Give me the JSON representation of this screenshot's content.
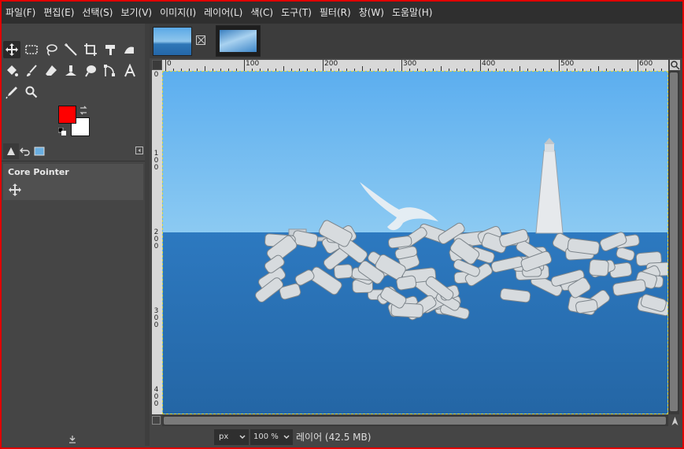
{
  "menu": [
    "파일(F)",
    "편집(E)",
    "선택(S)",
    "보기(V)",
    "이미지(I)",
    "레이어(L)",
    "색(C)",
    "도구(T)",
    "필터(R)",
    "창(W)",
    "도움말(H)"
  ],
  "tool_options": {
    "title": "Core Pointer"
  },
  "colors": {
    "foreground": "#ff0000",
    "background": "#ffffff",
    "accent": "#e00000"
  },
  "ruler": {
    "h_labels": [
      "0",
      "100",
      "200",
      "300",
      "400",
      "500",
      "600"
    ],
    "v_labels": [
      "0",
      "1 0 0",
      "2 0 0",
      "3 0 0",
      "4 0 0"
    ]
  },
  "status": {
    "unit": "px",
    "zoom": "100 %",
    "layer": "레이어 (42.5 MB)"
  },
  "icons": [
    "move-icon",
    "rect-select-icon",
    "lasso-icon",
    "fuzzy-select-icon",
    "crop-icon",
    "unified-transform-icon",
    "warp-icon",
    "bucket-fill-icon",
    "paintbrush-icon",
    "eraser-icon",
    "clone-icon",
    "smudge-icon",
    "path-icon",
    "text-icon",
    "color-picker-icon",
    "zoom-icon"
  ]
}
